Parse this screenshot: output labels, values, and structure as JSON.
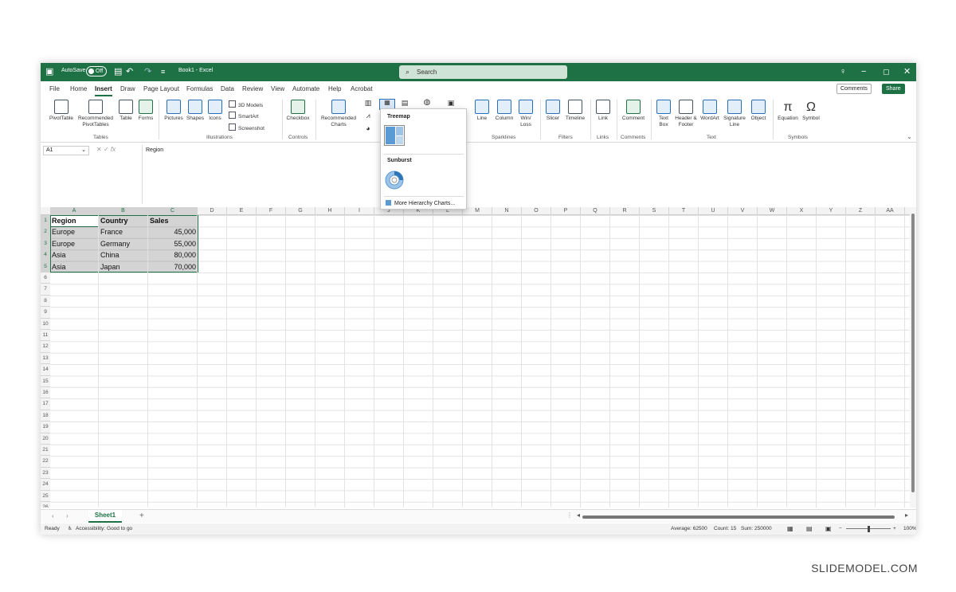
{
  "titlebar": {
    "autosave_label": "AutoSave",
    "autosave_state": "Off",
    "doc_title": "Book1 - Excel",
    "search_placeholder": "Search"
  },
  "menu": {
    "tabs": [
      "File",
      "Home",
      "Insert",
      "Draw",
      "Page Layout",
      "Formulas",
      "Data",
      "Review",
      "View",
      "Automate",
      "Help",
      "Acrobat"
    ],
    "active_tab": "Insert",
    "comments_label": "Comments",
    "share_label": "Share"
  },
  "ribbon": {
    "pivottable": "PivotTable",
    "recommended_pivottables": "Recommended PivotTables",
    "table": "Table",
    "forms": "Forms",
    "pictures": "Pictures",
    "shapes": "Shapes",
    "icons": "Icons",
    "3d_models": "3D Models",
    "smartart": "SmartArt",
    "screenshot": "Screenshot",
    "checkbox": "Checkbox",
    "recommended_charts": "Recommended Charts",
    "line": "Line",
    "column": "Column",
    "winloss": "Win/ Loss",
    "slicer": "Slicer",
    "timeline": "Timeline",
    "link": "Link",
    "comment": "Comment",
    "textbox": "Text Box",
    "header_footer": "Header & Footer",
    "wordart": "WordArt",
    "signature_line": "Signature Line",
    "object": "Object",
    "equation": "Equation",
    "symbol": "Symbol",
    "groups": {
      "tables": "Tables",
      "illustrations": "Illustrations",
      "controls": "Controls",
      "sparklines": "Sparklines",
      "filters": "Filters",
      "links": "Links",
      "comments": "Comments",
      "text": "Text",
      "symbols": "Symbols"
    }
  },
  "formula_bar": {
    "name_box": "A1",
    "fx": "fx",
    "value": "Region"
  },
  "columns": [
    "A",
    "B",
    "C",
    "D",
    "E",
    "F",
    "G",
    "H",
    "I",
    "J",
    "K",
    "L",
    "M",
    "N",
    "O",
    "P",
    "Q",
    "R",
    "S",
    "T",
    "U",
    "V",
    "W",
    "X",
    "Y",
    "Z",
    "AA"
  ],
  "rows": [
    "1",
    "2",
    "3",
    "4",
    "5",
    "6",
    "7",
    "8",
    "9",
    "10",
    "11",
    "12",
    "13",
    "14",
    "15",
    "16",
    "17",
    "18",
    "19",
    "20",
    "21",
    "22",
    "23",
    "24",
    "25",
    "26"
  ],
  "table": {
    "headers": [
      "Region",
      "Country",
      "Sales"
    ],
    "rows": [
      [
        "Europe",
        "France",
        "45,000"
      ],
      [
        "Europe",
        "Germany",
        "55,000"
      ],
      [
        "Asia",
        "China",
        "80,000"
      ],
      [
        "Asia",
        "Japan",
        "70,000"
      ]
    ]
  },
  "dropdown": {
    "treemap_heading": "Treemap",
    "sunburst_heading": "Sunburst",
    "more_label": "More Hierarchy Charts..."
  },
  "sheet_tab": "Sheet1",
  "status": {
    "ready": "Ready",
    "accessibility": "Accessibility: Good to go",
    "average": "Average: 62500",
    "count": "Count: 15",
    "sum": "Sum: 250000",
    "zoom": "100%"
  },
  "watermark": "SLIDEMODEL.COM"
}
